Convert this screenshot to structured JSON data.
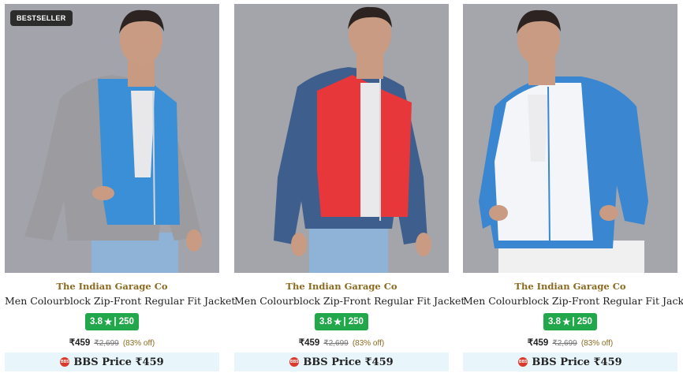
{
  "products": [
    {
      "badge": "BESTSELLER",
      "brand": "The Indian Garage Co",
      "title": "Men Colourblock Zip-Front Regular Fit Jacket",
      "rating": "3.8",
      "star": "★",
      "reviews": "| 250",
      "price": "₹459",
      "mrp": "₹2,699",
      "discount": "(83% off)",
      "bbs_label": "BBS Price ₹459",
      "colors": {
        "bg": "#a3a3ab",
        "sleeve": "#9c9ca0",
        "front": "#3b8fd6",
        "shirt": "#e8e8ea",
        "jeans": "#8fb3d6"
      }
    },
    {
      "brand": "The Indian Garage Co",
      "title": "Men Colourblock Zip-Front Regular Fit Jacket",
      "rating": "3.8",
      "star": "★",
      "reviews": "| 250",
      "price": "₹459",
      "mrp": "₹2,699",
      "discount": "(83% off)",
      "bbs_label": "BBS Price ₹459",
      "colors": {
        "bg": "#a4a4ab",
        "sleeve": "#3e5f8e",
        "front": "#e8373b",
        "shirt": "#e9e9ec",
        "jeans": "#8fb3d6"
      }
    },
    {
      "brand": "The Indian Garage Co",
      "title": "Men Colourblock Zip-Front Regular Fit Jacket",
      "rating": "3.8",
      "star": "★",
      "reviews": "| 250",
      "price": "₹459",
      "mrp": "₹2,699",
      "discount": "(83% off)",
      "bbs_label": "BBS Price ₹459",
      "colors": {
        "bg": "#a5a5ac",
        "sleeve": "#3a86d0",
        "front": "#f3f5f8",
        "shirt": "#ececee",
        "jeans": "#f0f0f0"
      }
    }
  ],
  "bbs_icon_text": "BBS"
}
